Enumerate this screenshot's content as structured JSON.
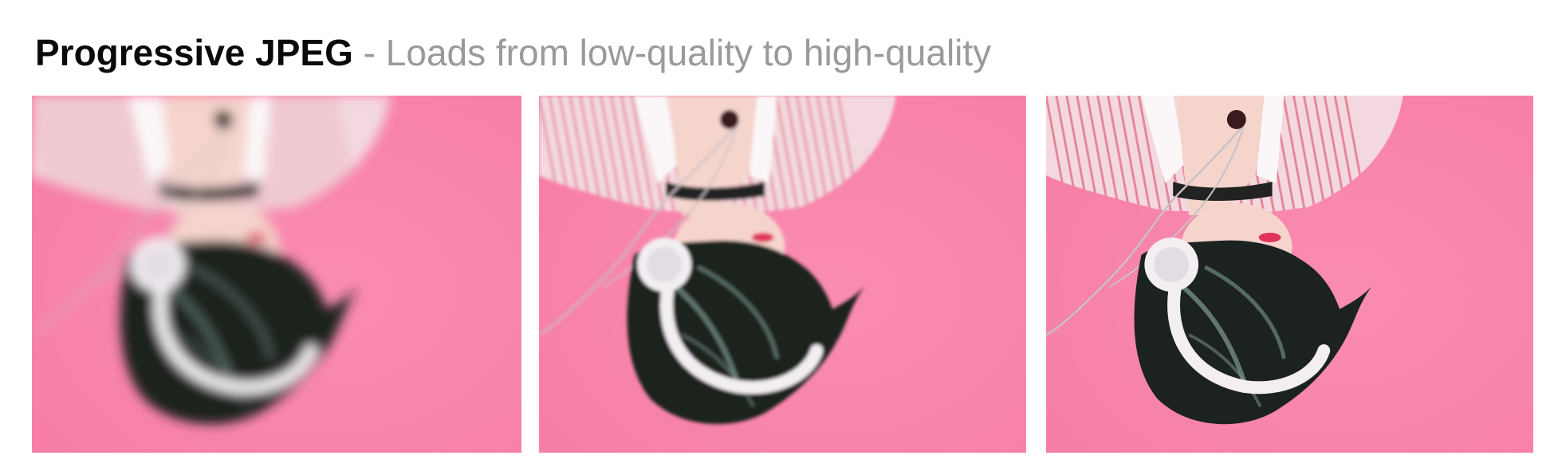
{
  "header": {
    "title": "Progressive JPEG",
    "separator": " - ",
    "subtitle": "Loads from low-quality to high-quality"
  },
  "stages": [
    {
      "id": "low",
      "blur": 7.0,
      "pixelated": true
    },
    {
      "id": "medium",
      "blur": 2.2,
      "pixelated": true
    },
    {
      "id": "high",
      "blur": 0.0,
      "pixelated": false
    }
  ],
  "colors": {
    "background": "#f77fa7",
    "shirt": "#f3d9df",
    "stripe": "#d9465f",
    "skin": "#f5d4cc",
    "hair": "#1b221f",
    "hair_highlight": "#7f9b92",
    "headphones": "#f2eef2",
    "cable": "#c8c0c6",
    "choker": "#222222",
    "lips": "#e0345c"
  }
}
